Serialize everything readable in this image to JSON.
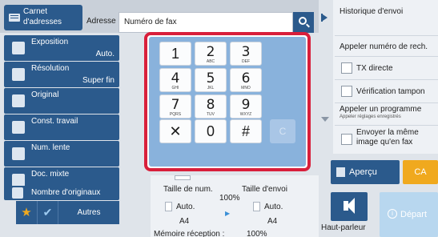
{
  "header": {
    "address_book_label": "Carnet d'adresses",
    "address_label": "Adresse",
    "fax_input_value": "Numéro de fax",
    "search_icon": "search-icon"
  },
  "left_menu": {
    "exposure": {
      "label": "Exposition",
      "value": "Auto."
    },
    "resolution": {
      "label": "Résolution",
      "value": "Super fin"
    },
    "original": {
      "label": "Original"
    },
    "const_job": {
      "label": "Const. travail"
    },
    "slow_num": {
      "label": "Num. lente"
    },
    "mixed_doc": {
      "label": "Doc. mixte"
    },
    "originals_count": {
      "label": "Nombre d'originaux"
    },
    "others_label": "Autres"
  },
  "keypad": {
    "keys": [
      {
        "digit": "1",
        "letters": ""
      },
      {
        "digit": "2",
        "letters": "ABC"
      },
      {
        "digit": "3",
        "letters": "DEF"
      },
      {
        "digit": "4",
        "letters": "GHI"
      },
      {
        "digit": "5",
        "letters": "JKL"
      },
      {
        "digit": "6",
        "letters": "MNO"
      },
      {
        "digit": "7",
        "letters": "PQRS"
      },
      {
        "digit": "8",
        "letters": "TUV"
      },
      {
        "digit": "9",
        "letters": "WXYZ"
      },
      {
        "digit": "✕",
        "letters": ""
      },
      {
        "digit": "0",
        "letters": ""
      },
      {
        "digit": "#",
        "letters": ""
      }
    ],
    "clear_label": "C"
  },
  "bottom_info": {
    "scan_size_label": "Taille de num.",
    "send_size_label": "Taille d'envoi",
    "ratio": "100%",
    "scan_size_mode": "Auto.",
    "send_size_mode": "Auto.",
    "scan_paper": "A4",
    "send_paper": "A4",
    "memory_label": "Mémoire réception :",
    "memory_value": "100%"
  },
  "right_panel": {
    "items": [
      "Historique d'envoi",
      "Appeler numéro de rech.",
      "TX directe",
      "Vérification tampon",
      "Appeler un programme",
      "Appeler réglages enregistrés",
      "Envoyer la même image qu'en fax"
    ],
    "preview_label": "Aperçu",
    "ca_label": "CA",
    "speaker_label": "Haut-parleur",
    "start_label": "Départ"
  },
  "colors": {
    "primary": "#2b5a8c",
    "accent_orange": "#f0a91e",
    "highlight_red": "#d81f3b",
    "keypad_bg": "#89b2dc"
  }
}
